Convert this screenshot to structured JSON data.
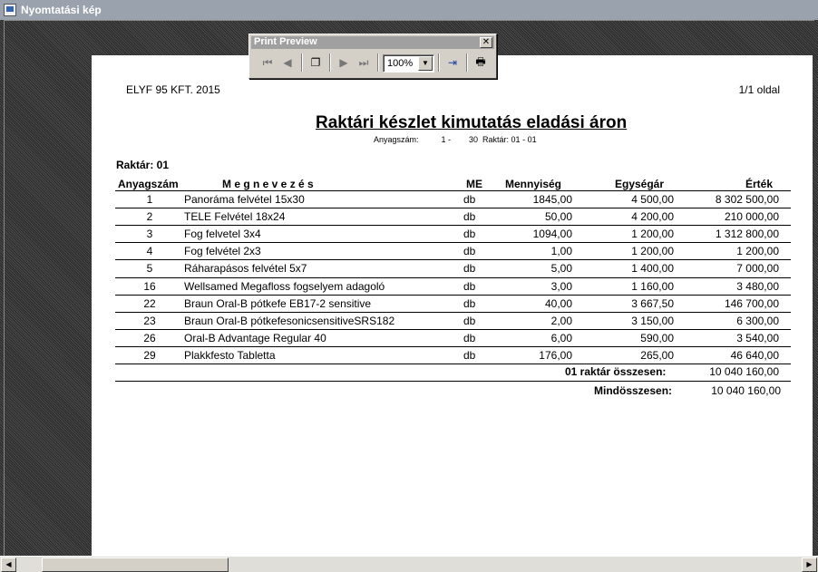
{
  "window": {
    "title": "Nyomtatási kép"
  },
  "toolbar": {
    "caption": "Print Preview",
    "close": "✕",
    "first_icon": "⏮",
    "prev_icon": "◀",
    "multipage_icon": "❐",
    "next_icon": "▶",
    "last_icon": "⏭",
    "zoom": "100%",
    "zoom_arrow": "▼",
    "exit_icon": "⇥",
    "print_icon": "🖶"
  },
  "report": {
    "company": "ELYF 95 KFT. 2015",
    "page": "1/1 oldal",
    "title": "Raktári készlet kimutatás eladási áron",
    "subtitle": "Anyagszám:          1 -        30  Raktár: 01 - 01",
    "warehouse": "Raktár:  01",
    "columns": {
      "code": "Anyagszám",
      "name": "M e g n e v e z é s",
      "unit": "ME",
      "qty": "Mennyiség",
      "price": "Egységár",
      "value": "Érték"
    },
    "rows": [
      {
        "code": "1",
        "name": "Panoráma felvétel 15x30",
        "unit": "db",
        "qty": "1845,00",
        "price": "4 500,00",
        "value": "8 302 500,00"
      },
      {
        "code": "2",
        "name": "TELE Felvétel 18x24",
        "unit": "db",
        "qty": "50,00",
        "price": "4 200,00",
        "value": "210 000,00"
      },
      {
        "code": "3",
        "name": "Fog felvetel 3x4",
        "unit": "db",
        "qty": "1094,00",
        "price": "1 200,00",
        "value": "1 312 800,00"
      },
      {
        "code": "4",
        "name": "Fog felvétel 2x3",
        "unit": "db",
        "qty": "1,00",
        "price": "1 200,00",
        "value": "1 200,00"
      },
      {
        "code": "5",
        "name": "Ráharapásos felvétel 5x7",
        "unit": "db",
        "qty": "5,00",
        "price": "1 400,00",
        "value": "7 000,00"
      },
      {
        "code": "16",
        "name": "Wellsamed Megafloss fogselyem adagoló",
        "unit": "db",
        "qty": "3,00",
        "price": "1 160,00",
        "value": "3 480,00"
      },
      {
        "code": "22",
        "name": "Braun Oral-B pótkefe EB17-2 sensitive",
        "unit": "db",
        "qty": "40,00",
        "price": "3 667,50",
        "value": "146 700,00"
      },
      {
        "code": "23",
        "name": "Braun Oral-B pótkefesonicsensitiveSRS182",
        "unit": "db",
        "qty": "2,00",
        "price": "3 150,00",
        "value": "6 300,00"
      },
      {
        "code": "26",
        "name": "Oral-B Advantage Regular 40",
        "unit": "db",
        "qty": "6,00",
        "price": "590,00",
        "value": "3 540,00"
      },
      {
        "code": "29",
        "name": "Plakkfesto Tabletta",
        "unit": "db",
        "qty": "176,00",
        "price": "265,00",
        "value": "46 640,00"
      }
    ],
    "subtotal_label": "01 raktár összesen:",
    "subtotal_value": "10 040 160,00",
    "total_label": "Mindösszesen:",
    "total_value": "10 040 160,00"
  },
  "scrollbar": {
    "left_arrow": "◀",
    "right_arrow": "▶"
  }
}
